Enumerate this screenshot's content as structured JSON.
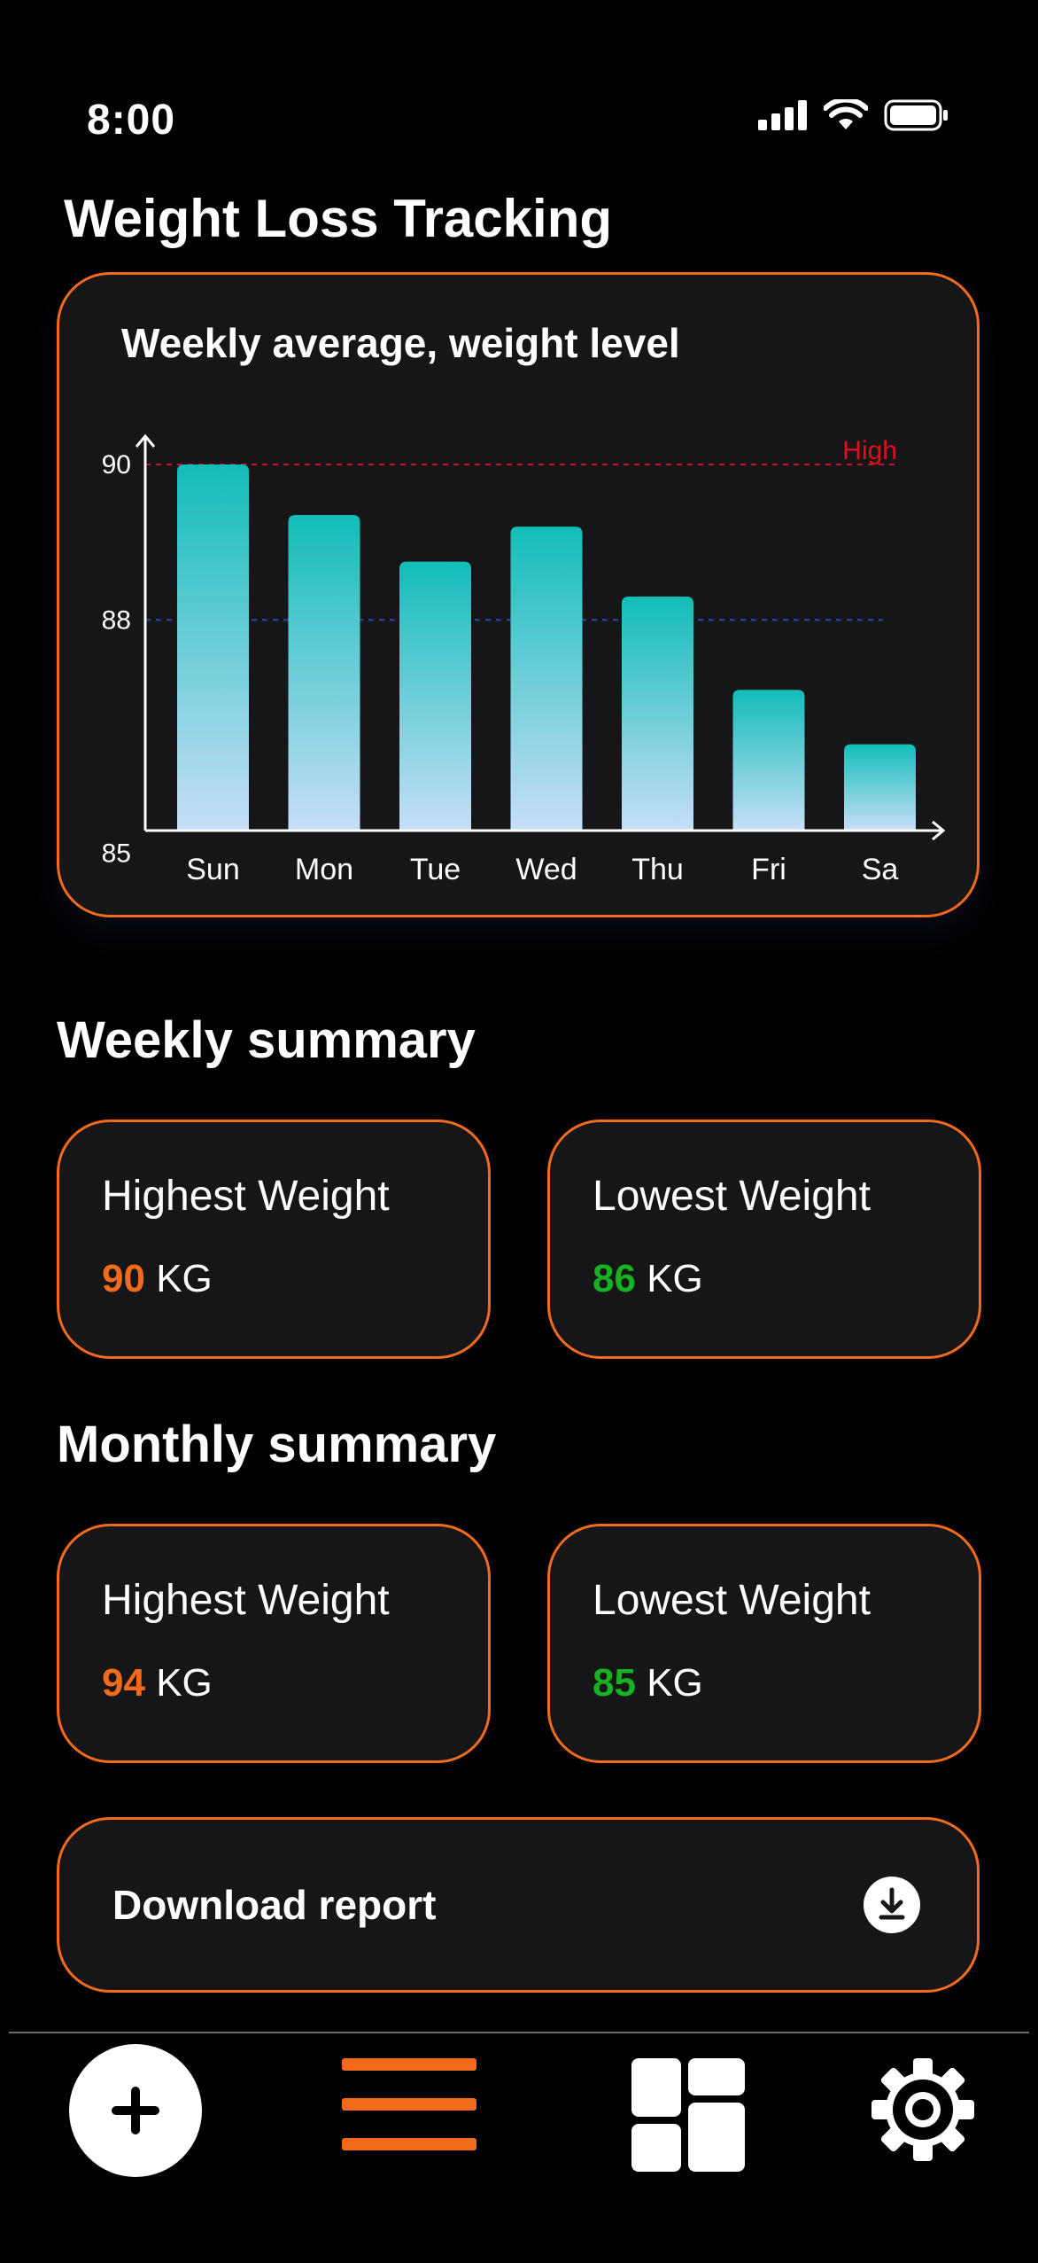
{
  "status_bar": {
    "time": "8:00"
  },
  "page": {
    "title": "Weight Loss Tracking"
  },
  "chart_card": {
    "title": "Weekly average, weight level",
    "high_label": "High"
  },
  "chart_data": {
    "type": "bar",
    "title": "Weekly average, weight level",
    "categories": [
      "Sun",
      "Mon",
      "Tue",
      "Wed",
      "Thu",
      "Fri",
      "Sa"
    ],
    "values": [
      90,
      89.35,
      88.75,
      89.2,
      88.3,
      87.1,
      86.4
    ],
    "yticks": [
      85,
      88,
      90
    ],
    "ylim": [
      85.3,
      90
    ],
    "reference_lines": [
      {
        "label": "High",
        "value": 90,
        "color": "#c8102e"
      },
      {
        "label": "",
        "value": 88,
        "color": "#2b4aa0"
      }
    ],
    "bar_gradient": [
      "#12bdb8",
      "#c7def9"
    ]
  },
  "weekly_summary": {
    "title": "Weekly summary",
    "highest": {
      "label": "Highest Weight",
      "value": "90",
      "unit": "KG"
    },
    "lowest": {
      "label": "Lowest Weight",
      "value": "86",
      "unit": "KG"
    }
  },
  "monthly_summary": {
    "title": "Monthly summary",
    "highest": {
      "label": "Highest Weight",
      "value": "94",
      "unit": "KG"
    },
    "lowest": {
      "label": "Lowest Weight",
      "value": "85",
      "unit": "KG"
    }
  },
  "download": {
    "label": "Download report"
  },
  "colors": {
    "accent": "#f26b1d",
    "high": "#f26b1d",
    "low": "#17b222",
    "card": "#161618"
  },
  "nav": {
    "items": [
      {
        "icon": "plus-icon"
      },
      {
        "icon": "menu-icon",
        "active": true
      },
      {
        "icon": "dashboard-icon"
      },
      {
        "icon": "gear-icon"
      }
    ]
  }
}
